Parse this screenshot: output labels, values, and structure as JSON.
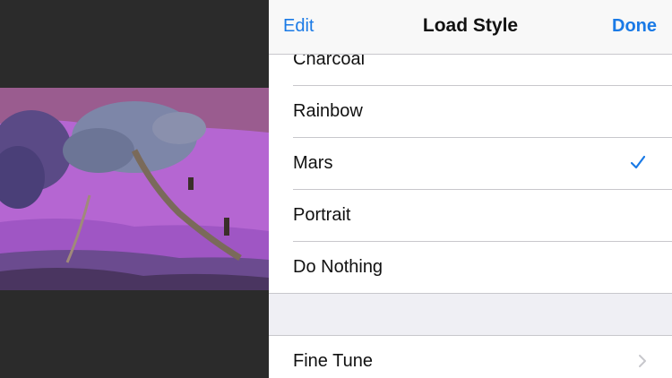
{
  "navbar": {
    "left_label": "Edit",
    "title": "Load Style",
    "right_label": "Done"
  },
  "styles": {
    "items": [
      {
        "label": "Charcoal",
        "selected": false
      },
      {
        "label": "Rainbow",
        "selected": false
      },
      {
        "label": "Mars",
        "selected": true
      },
      {
        "label": "Portrait",
        "selected": false
      },
      {
        "label": "Do Nothing",
        "selected": false
      }
    ]
  },
  "settings": {
    "fine_tune_label": "Fine Tune"
  },
  "colors": {
    "accent": "#1a7ae6",
    "photo_tint": "#b56ad6",
    "separator": "#c8c7cc",
    "group_background": "#efeff4"
  },
  "icons": {
    "selected_mark": "checkmark-icon",
    "disclosure": "chevron-right-icon"
  }
}
